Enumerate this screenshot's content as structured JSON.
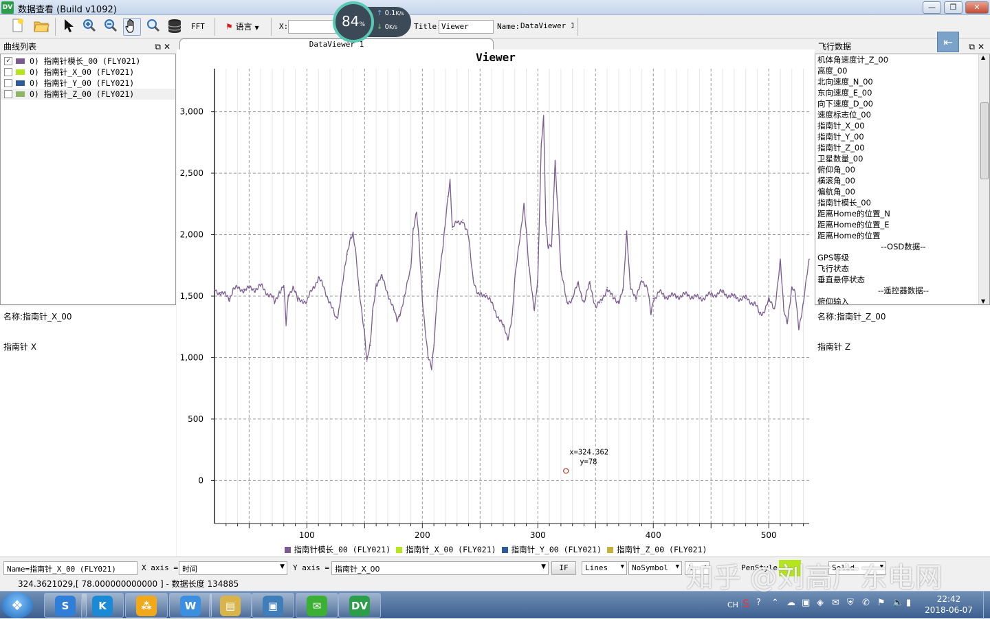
{
  "window": {
    "app_icon": "DV",
    "title": "数据查看 (Build v1092)",
    "buttons": {
      "minimize": "—",
      "maximize": "❐",
      "close": "✕"
    }
  },
  "toolbar": {
    "fft_label": "FFT",
    "language_label": "语言",
    "x_label": "X:",
    "x_value": "",
    "title_label": "Title:",
    "title_value": "Viewer",
    "name_label": "Name:",
    "name_value": "DataViewer 1"
  },
  "netmon": {
    "percent": "84",
    "percent_unit": "%",
    "upload": "0.1",
    "upload_unit": "K/s",
    "download": "0",
    "download_unit": "K/s"
  },
  "curve_panel": {
    "title": "曲线列表",
    "items": [
      {
        "label": "0) 指南针模长_00 (FLY021)",
        "checked": true,
        "color": "#7b5c92"
      },
      {
        "label": "0) 指南针_X_00 (FLY021)",
        "checked": false,
        "color": "#b5e61d"
      },
      {
        "label": "0) 指南针_Y_00 (FLY021)",
        "checked": false,
        "color": "#2e5a97"
      },
      {
        "label": "0) 指南针_Z_00 (FLY021)",
        "checked": false,
        "color": "#8fb466"
      }
    ]
  },
  "left_info": {
    "name_line": "名称:指南针_X_00",
    "desc_line": "指南针 X"
  },
  "tab": {
    "label": "DataViewer 1"
  },
  "flight_panel": {
    "title": "飞行数据",
    "items": [
      "机体角速度计_Z_00",
      "高度_00",
      "北向速度_N_00",
      "东向速度_E_00",
      "向下速度_D_00",
      "速度标志位_00",
      "指南针_X_00",
      "指南针_Y_00",
      "指南针_Z_00",
      "卫星数量_00",
      "俯仰角_00",
      "横滚角_00",
      "偏航角_00",
      "指南针模长_00",
      "距离Home的位置_N",
      "距离Home的位置_E",
      "距离Home的位置",
      "--OSD数据--",
      "GPS等级",
      "飞行状态",
      "垂直悬停状态",
      "--遥控器数据--",
      "俯仰输入"
    ]
  },
  "right_info": {
    "name_line": "名称:指南针_Z_00",
    "desc_line": "指南针 Z"
  },
  "chart_data": {
    "type": "line",
    "title": "Viewer",
    "xlim": [
      20,
      535
    ],
    "ylim": [
      -350,
      3350
    ],
    "xticks": [
      100,
      200,
      300,
      400,
      500
    ],
    "yticks": [
      0,
      500,
      1000,
      1500,
      2000,
      2500,
      3000
    ],
    "ytick_labels": [
      "0",
      "500",
      "1,000",
      "1,500",
      "2,000",
      "2,500",
      "3,000"
    ],
    "grid": true,
    "legend_position": "bottom",
    "series": [
      {
        "name": "指南针模长_00 (FLY021)",
        "color": "#7b5c92",
        "visible": true,
        "x": [
          20,
          25,
          30,
          33,
          36,
          45,
          55,
          60,
          70,
          72,
          76,
          80,
          82,
          84,
          88,
          90,
          92,
          97,
          100,
          104,
          106,
          110,
          115,
          120,
          125,
          127,
          130,
          135,
          138,
          140,
          142,
          145,
          150,
          152,
          155,
          157,
          160,
          165,
          170,
          175,
          178,
          180,
          185,
          190,
          192,
          195,
          197,
          200,
          205,
          208,
          210,
          213,
          218,
          222,
          224,
          226,
          230,
          235,
          237,
          240,
          244,
          248,
          255,
          262,
          266,
          270,
          274,
          278,
          280,
          285,
          288,
          290,
          292,
          297,
          300,
          303,
          305,
          307,
          309,
          312,
          315,
          318,
          320,
          325,
          330,
          335,
          340,
          345,
          350,
          355,
          360,
          365,
          370,
          374,
          377,
          380,
          385,
          390,
          395,
          398,
          400,
          405,
          410,
          420,
          430,
          440,
          450,
          460,
          470,
          480,
          488,
          492,
          495,
          500,
          505,
          510,
          513,
          516,
          520,
          523,
          526,
          530,
          535
        ],
        "y": [
          1550,
          1530,
          1500,
          1480,
          1560,
          1555,
          1560,
          1580,
          1490,
          1440,
          1540,
          1580,
          1260,
          1510,
          1580,
          1530,
          1460,
          1470,
          1450,
          1540,
          1580,
          1650,
          1560,
          1450,
          1310,
          1350,
          1560,
          1840,
          1990,
          2020,
          1880,
          1550,
          1210,
          970,
          1100,
          1380,
          1600,
          1650,
          1530,
          1390,
          1300,
          1350,
          1500,
          1740,
          2050,
          2180,
          1950,
          1480,
          1000,
          900,
          1100,
          1540,
          1900,
          2310,
          2450,
          2040,
          2100,
          2120,
          2050,
          1980,
          1650,
          1500,
          1520,
          1400,
          1330,
          1250,
          1160,
          1350,
          1620,
          2030,
          2250,
          2020,
          1750,
          1400,
          1630,
          2720,
          2970,
          2100,
          1900,
          1900,
          2600,
          2100,
          1700,
          1450,
          1480,
          1600,
          1450,
          1600,
          1420,
          1450,
          1570,
          1480,
          1460,
          1550,
          2020,
          1600,
          1460,
          1650,
          1550,
          1350,
          1480,
          1530,
          1500,
          1500,
          1510,
          1480,
          1510,
          1530,
          1490,
          1480,
          1440,
          1350,
          1370,
          1460,
          1400,
          1780,
          1380,
          1300,
          1560,
          1510,
          1250,
          1440,
          1800
        ]
      }
    ],
    "legend": [
      {
        "name": "指南针模长_00 (FLY021)",
        "color": "#7b5c92"
      },
      {
        "name": "指南针_X_00 (FLY021)",
        "color": "#b5e61d"
      },
      {
        "name": "指南针_Y_00 (FLY021)",
        "color": "#2e5a97"
      },
      {
        "name": "指南针_Z_00 (FLY021)",
        "color": "#c2b33c"
      }
    ],
    "marker": {
      "x": 324.362,
      "y": 78,
      "label_x": "x=324.362",
      "label_y": "y=78"
    }
  },
  "bottom_bar": {
    "name_label": "Name=",
    "name_value": "指南针_X_00 (FLY021)",
    "xaxis_label": "X axis =",
    "xaxis_value": "时间",
    "yaxis_label": "Y axis =",
    "yaxis_value": "指南针_X_00",
    "if_button": "IF",
    "line_style": "Lines",
    "symbol_style": "NoSymbol",
    "width_value": "1",
    "pen_style_label": "PenStyle:",
    "pen_color": "#b5e61d",
    "pen_value": "Solid"
  },
  "status": {
    "text": "324.3621029,[ 78.000000000000 ] - 数据长度 134885"
  },
  "watermark": {
    "text": "知乎 @刘高广东电网"
  },
  "taskbar": {
    "start": "❖",
    "tasks": [
      {
        "icon": "S",
        "color": "#2f7fd8"
      },
      {
        "icon": "K",
        "color": "#1b8ad6"
      },
      {
        "icon": "⁂",
        "color": "#f1a81a"
      },
      {
        "icon": "W",
        "color": "#3b8fe0"
      },
      {
        "icon": "▤",
        "color": "#d9b44a"
      },
      {
        "icon": "▣",
        "color": "#3f7eb8"
      },
      {
        "icon": "✉",
        "color": "#3cb034"
      },
      {
        "icon": "DV",
        "color": "#2c9e4a"
      }
    ],
    "tray_lang": "CH",
    "time": "22:42",
    "date": "2018-06-07"
  }
}
